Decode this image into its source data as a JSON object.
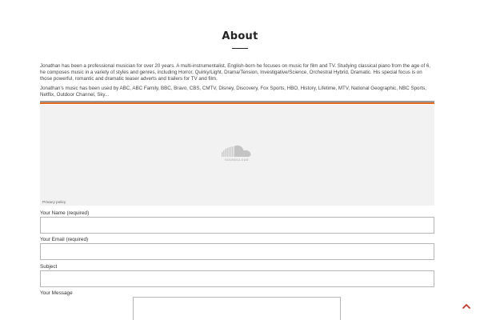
{
  "page": {
    "title": "About",
    "paragraphs": [
      "Jonathan has been a professional musician for over 20 years. A multi-instrumentalist, English-born he focuses on music for film and TV. Studying classical piano from the age of 6, he composes music in a variety of styles and genres, including Horror, Quirky/Light, Drama/Tension, Investigative/Science, Orchestral Hybrid, Dramatic. His special focus is on those powerful, romantic and dramatic teaser adverts and trailers for TV and film.",
      "Jonathan's music has been used by ABC, ABC Family, BBC, Bravo, CBS, CMTV, Disney, Discovery, Fox Sports, HBO, History, Lifetime, MTV, National Geographic, NBC Sports, Netflix, Outdoor Channel, Sky..."
    ]
  },
  "embed": {
    "logo_text": "SOUNDCLOUD",
    "privacy_link": "Privacy policy",
    "logo_icon": "soundcloud-icon",
    "stripe_colors": [
      "#9a9a9a",
      "#e36b21"
    ]
  },
  "form": {
    "name_label": "Your Name (required)",
    "email_label": "Your Email (required)",
    "subject_label": "Subject",
    "message_label": "Your Message"
  },
  "controls": {
    "back_to_top_icon": "chevron-up-icon",
    "accent": "#c0392b"
  }
}
